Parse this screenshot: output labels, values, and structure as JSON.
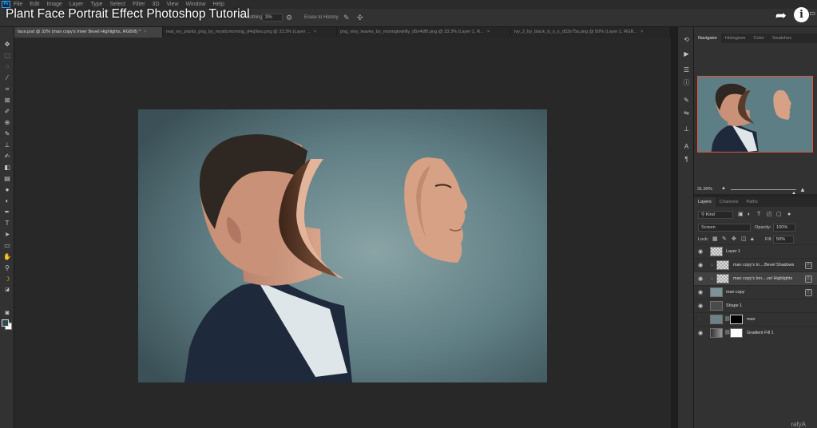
{
  "video": {
    "title": "Plant Face Portrait Effect Photoshop Tutorial",
    "watermark": "rafyA"
  },
  "menubar": {
    "logo": "Ps",
    "items": [
      "File",
      "Edit",
      "Image",
      "Layer",
      "Type",
      "Select",
      "Filter",
      "3D",
      "View",
      "Window",
      "Help"
    ]
  },
  "options_bar": {
    "smoothing_label": "Smoothing:",
    "smoothing_value": "3%",
    "erase_history": "Erase to History"
  },
  "doc_tabs": [
    {
      "label": "face.psd @ 32% (man copy's Inner Bevel Highlights, RGB/8) *",
      "close": "×"
    },
    {
      "label": "real_ivy_plants_png_by_mysticmorning_d4sj9wu.png @ 33.3% (Layer ...",
      "close": "×"
    },
    {
      "label": "png_viny_leaves_by_moonglowlilly_d5n4df5.png @ 33.3% (Layer 1, R...",
      "close": "×"
    },
    {
      "label": "ivy_2_by_black_b_o_x_d53s75a.png @ 50% (Layer 1, RGB...",
      "close": "×"
    }
  ],
  "panels": {
    "top_tabs": [
      "Navigator",
      "Histogram",
      "Color",
      "Swatches"
    ],
    "zoom_value": "31.99%",
    "layers_tabs": [
      "Layers",
      "Channels",
      "Paths"
    ],
    "filter_kind": "Kind",
    "blend_mode": "Screen",
    "opacity_label": "Opacity:",
    "opacity_value": "100%",
    "lock_label": "Lock:",
    "fill_label": "Fill:",
    "fill_value": "50%",
    "layers": [
      {
        "name": "Layer 1"
      },
      {
        "name": "man copy's In....Bevel Shadows"
      },
      {
        "name": "man copy's Inn....vel Highlights"
      },
      {
        "name": "man copy"
      },
      {
        "name": "Shape 1"
      },
      {
        "name": "man"
      },
      {
        "name": "Gradient Fill 1"
      }
    ]
  },
  "colors": {
    "accent": "#31a8ff",
    "navigator_border": "#e1533e",
    "canvas_bg": "#5d7e84"
  }
}
